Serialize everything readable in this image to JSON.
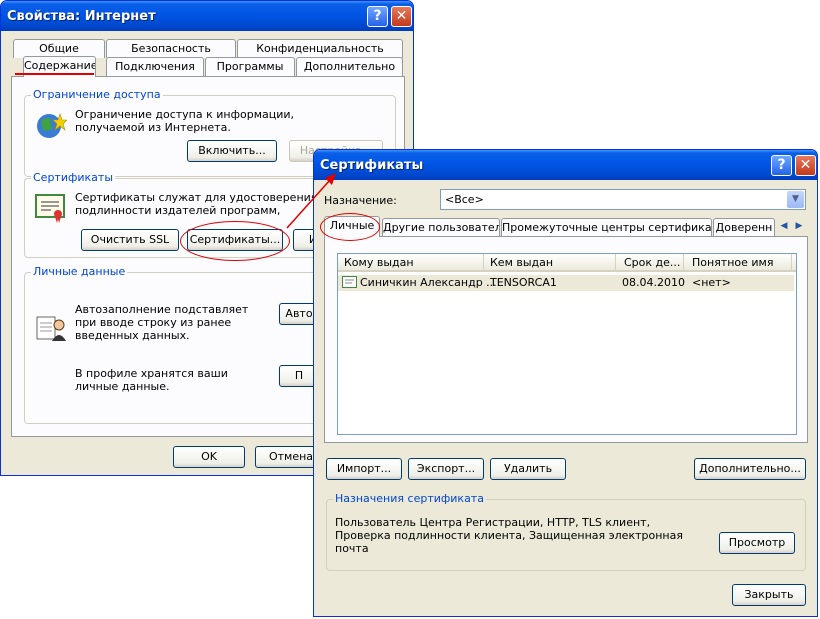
{
  "inet": {
    "title": "Свойства: Интернет",
    "tabs_row1": [
      "Общие",
      "Безопасность",
      "Конфиденциальность"
    ],
    "tabs_row2": [
      "Содержание",
      "Подключения",
      "Программы",
      "Дополнительно"
    ],
    "access": {
      "title": "Ограничение доступа",
      "desc": "Ограничение доступа к информации, получаемой из Интернета.",
      "enable": "Включить...",
      "settings": "Настройка..."
    },
    "certs": {
      "title": "Сертификаты",
      "desc": "Сертификаты служат для удостоверения подлинности издателей программ, центров сертификации.",
      "clear_ssl": "Очистить SSL",
      "certificates": "Сертификаты...",
      "publishers": "И"
    },
    "personal": {
      "title": "Личные данные",
      "autofill_desc": "Автозаполнение подставляет при вводе строку из ранее введенных данных.",
      "autofill_btn": "Авто",
      "profile_desc": "В профиле хранятся ваши личные данные.",
      "profile_btn": "П"
    },
    "ok": "OK",
    "cancel": "Отмена"
  },
  "certs_dialog": {
    "title": "Сертификаты",
    "purpose_label": "Назначение:",
    "purpose_value": "<Все>",
    "tabs": [
      "Личные",
      "Другие пользователи",
      "Промежуточные центры сертификации",
      "Доверенн"
    ],
    "columns": [
      "Кому выдан",
      "Кем выдан",
      "Срок де...",
      "Понятное имя"
    ],
    "rows": [
      {
        "issued_to": "Синичкин Александр ...",
        "issued_by": "TENSORCA1",
        "expires": "08.04.2010",
        "friendly": "<нет>"
      }
    ],
    "import": "Импорт...",
    "export": "Экспорт...",
    "delete": "Удалить",
    "advanced": "Дополнительно...",
    "purposes_title": "Назначения сертификата",
    "purposes_text": "Пользователь Центра Регистрации, HTTP, TLS клиент, Проверка подлинности клиента, Защищенная электронная почта",
    "view": "Просмотр",
    "close": "Закрыть"
  },
  "colors": {
    "title_blue": "#0054e3",
    "annotation_red": "#e00000",
    "select_blue": "#316ac5"
  }
}
